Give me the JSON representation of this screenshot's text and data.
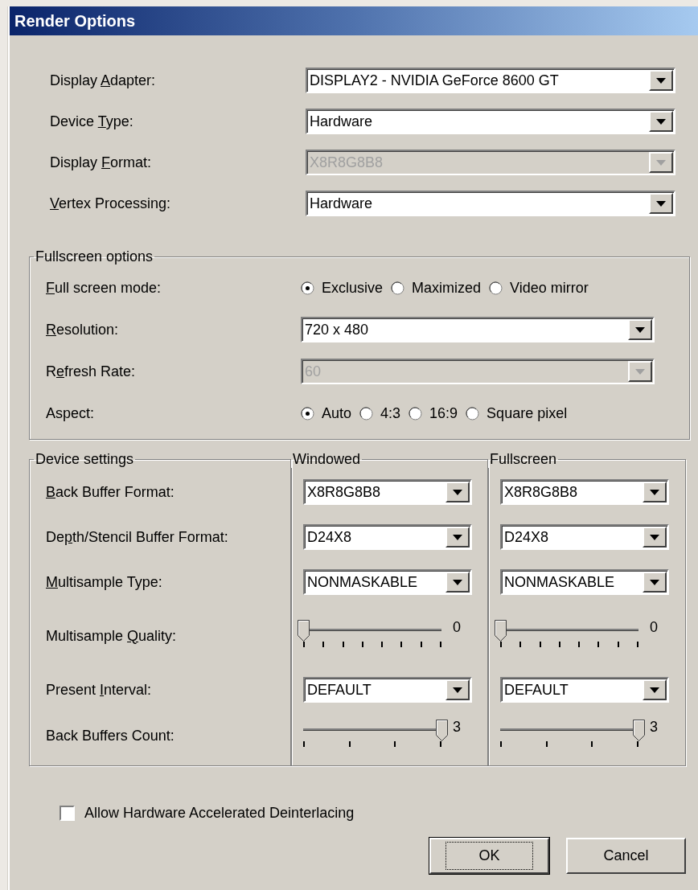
{
  "window": {
    "title": "Render Options"
  },
  "general": [
    {
      "label": {
        "before": "Display ",
        "accelerator": "A",
        "after": "dapter:"
      },
      "value": "DISPLAY2 - NVIDIA GeForce 8600 GT",
      "disabled": false
    },
    {
      "label": {
        "before": "Device ",
        "accelerator": "T",
        "after": "ype:"
      },
      "value": "Hardware",
      "disabled": false
    },
    {
      "label": {
        "before": "Display ",
        "accelerator": "F",
        "after": "ormat:"
      },
      "value": "X8R8G8B8",
      "disabled": true
    },
    {
      "label": {
        "accelerator": "V",
        "after": "ertex Processing:"
      },
      "value": "Hardware",
      "disabled": false
    }
  ],
  "fullscreen_options": {
    "title": "Fullscreen options",
    "rows": [
      {
        "kind": "radio",
        "label": {
          "accelerator": "F",
          "after": "ull screen mode:"
        },
        "options": [
          {
            "label": "Exclusive",
            "selected": true
          },
          {
            "label": "Maximized",
            "selected": false
          },
          {
            "label": "Video mirror",
            "selected": false
          }
        ]
      },
      {
        "kind": "combo",
        "label": {
          "accelerator": "R",
          "after": "esolution:"
        },
        "value": "720 x 480",
        "disabled": false
      },
      {
        "kind": "combo",
        "label": {
          "before": "R",
          "accelerator": "e",
          "after": "fresh Rate:"
        },
        "value": "60",
        "disabled": true
      },
      {
        "kind": "radio",
        "label": {
          "before": "Aspect:"
        },
        "options": [
          {
            "label": "Auto",
            "selected": true
          },
          {
            "label": "4:3",
            "selected": false
          },
          {
            "label": "16:9",
            "selected": false
          },
          {
            "label": "Square pixel",
            "selected": false
          }
        ]
      }
    ]
  },
  "device_settings": {
    "title": "Device settings",
    "columns": [
      {
        "title": "Windowed"
      },
      {
        "title": "Fullscreen"
      }
    ],
    "rows": [
      {
        "kind": "combo",
        "label": {
          "accelerator": "B",
          "after": "ack Buffer Format:"
        },
        "values": [
          "X8R8G8B8",
          "X8R8G8B8"
        ]
      },
      {
        "kind": "combo",
        "label": {
          "before": "De",
          "accelerator": "p",
          "after": "th/Stencil Buffer Format:"
        },
        "values": [
          "D24X8",
          "D24X8"
        ]
      },
      {
        "kind": "combo",
        "label": {
          "accelerator": "M",
          "after": "ultisample Type:"
        },
        "values": [
          "NONMASKABLE",
          "NONMASKABLE"
        ]
      },
      {
        "kind": "slider",
        "label": {
          "before": "Multisample ",
          "accelerator": "Q",
          "after": "uality:"
        },
        "sliders": [
          {
            "level": 0,
            "reading": "0"
          },
          {
            "level": 0,
            "reading": "0"
          }
        ]
      },
      {
        "kind": "combo",
        "label": {
          "before": "Present ",
          "accelerator": "I",
          "after": "nterval:"
        },
        "values": [
          "DEFAULT",
          "DEFAULT"
        ]
      },
      {
        "kind": "slider",
        "label": {
          "before": "Back Buffers Count:"
        },
        "sliders": [
          {
            "level": 1,
            "reading": "3"
          },
          {
            "level": 1,
            "reading": "3"
          }
        ]
      }
    ]
  },
  "deinterlacing": {
    "label": "Allow Hardware Accelerated Deinterlacing",
    "checked": false
  },
  "buttons": [
    {
      "label": "OK",
      "default": true
    },
    {
      "label": "Cancel",
      "default": false
    }
  ]
}
